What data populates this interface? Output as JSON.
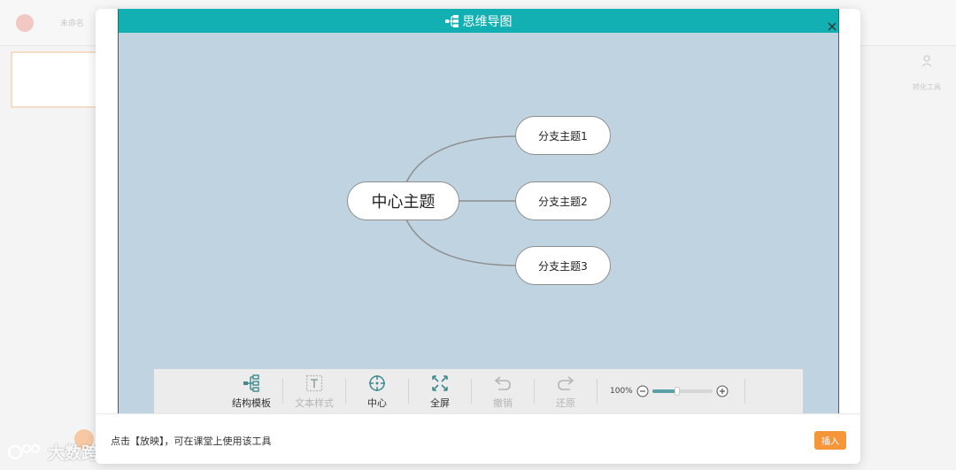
{
  "background_app": {
    "title": "未命名",
    "right_panel_label": "转化工具",
    "watermark": "大数跨境"
  },
  "modal": {
    "title": "思维导图",
    "close_icon": "close-icon",
    "mindmap": {
      "center_topic": "中心主题",
      "branches": [
        "分支主题1",
        "分支主题2",
        "分支主题3"
      ]
    },
    "toolbar": {
      "structure_template": "结构模板",
      "text_style": "文本样式",
      "center": "中心",
      "fullscreen": "全屏",
      "undo": "撤销",
      "redo": "还原",
      "zoom_level": "100%",
      "zoom_fraction": 0.42
    },
    "footer": {
      "hint": "点击【放映】，可在课堂上使用该工具",
      "insert_label": "插入"
    }
  },
  "colors": {
    "header": "#12b0b3",
    "canvas": "#c0d3e1",
    "insert_button": "#f7953b"
  }
}
